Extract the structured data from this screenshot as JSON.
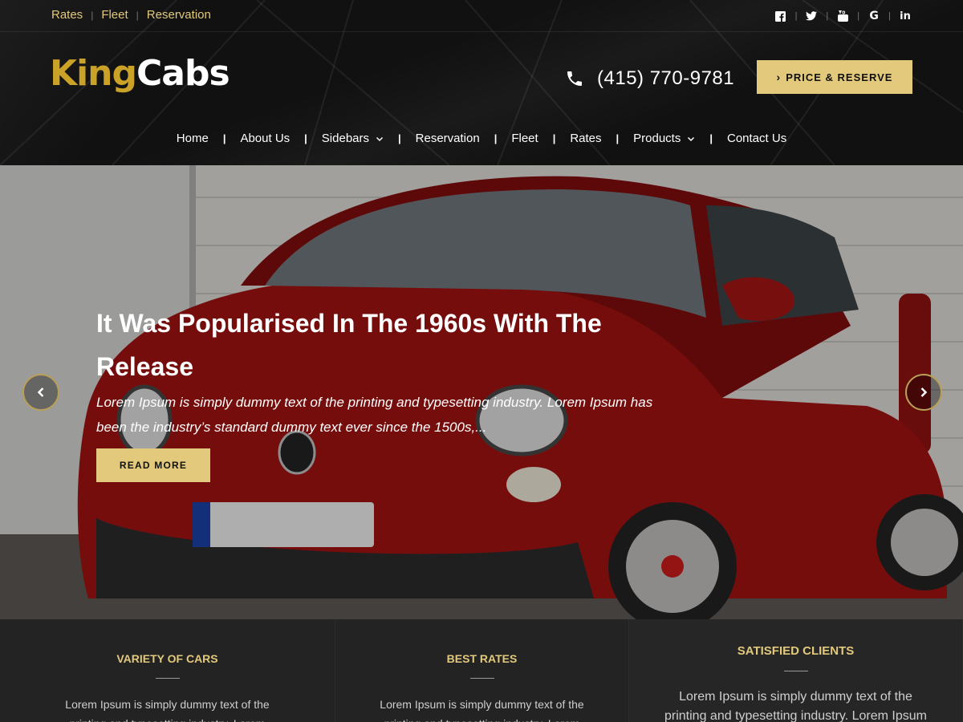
{
  "topbar": {
    "links": [
      "Rates",
      "Fleet",
      "Reservation"
    ],
    "social": [
      "facebook-icon",
      "twitter-icon",
      "youtube-icon",
      "google-icon",
      "linkedin-icon"
    ]
  },
  "brand": {
    "part1": "King",
    "part2": "Cabs",
    "color_gold": "#c9a227"
  },
  "contact": {
    "phone": "(415) 770-9781"
  },
  "header": {
    "reserve_label": "PRICE & RESERVE"
  },
  "nav": {
    "items": [
      {
        "label": "Home"
      },
      {
        "label": "About Us"
      },
      {
        "label": "Sidebars",
        "dropdown": true
      },
      {
        "label": "Reservation"
      },
      {
        "label": "Fleet"
      },
      {
        "label": "Rates"
      },
      {
        "label": "Products",
        "dropdown": true
      },
      {
        "label": "Contact Us"
      }
    ]
  },
  "slide": {
    "title": "It Was Popularised In The 1960s With The Release",
    "text": "Lorem Ipsum is simply dummy text of the printing and typesetting industry. Lorem Ipsum has been the industry’s standard dummy text ever since the 1500s,...",
    "button": "READ MORE"
  },
  "features": [
    {
      "title": "VARIETY OF CARS",
      "text": "Lorem Ipsum is simply dummy text of the printing and typesetting industry. Lorem Ipsum"
    },
    {
      "title": "BEST RATES",
      "text": "Lorem Ipsum is simply dummy text of the printing and typesetting industry. Lorem Ipsum"
    },
    {
      "title": "SATISFIED CLIENTS",
      "text": "Lorem Ipsum is simply dummy text of the printing and typesetting industry. Lorem Ipsum"
    }
  ],
  "colors": {
    "accent": "#e2c97c",
    "background": "#111111"
  }
}
